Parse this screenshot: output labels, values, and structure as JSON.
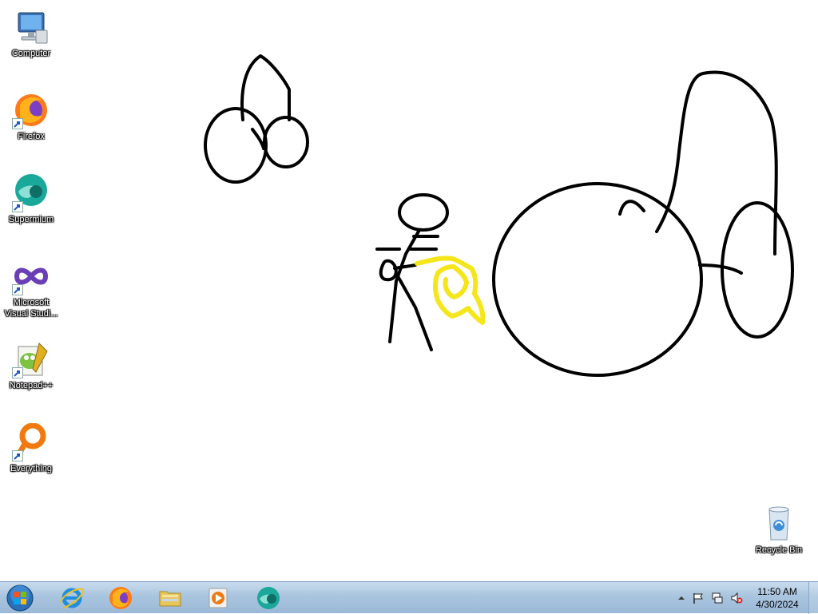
{
  "desktop": {
    "icons": [
      {
        "label": "Computer",
        "icon": "computer-icon"
      },
      {
        "label": "Firefox",
        "icon": "firefox-icon"
      },
      {
        "label": "Supermium",
        "icon": "supermium-icon"
      },
      {
        "label": "Microsoft Visual Studi...",
        "icon": "visual-studio-icon"
      },
      {
        "label": "Notepad++",
        "icon": "notepadpp-icon"
      },
      {
        "label": "Everything",
        "icon": "everything-icon"
      }
    ],
    "recycle_bin": {
      "label": "Recycle Bin",
      "icon": "recycle-bin-icon"
    }
  },
  "taskbar": {
    "start": "start-button",
    "pinned": [
      {
        "name": "internet-explorer",
        "icon": "ie-icon"
      },
      {
        "name": "firefox",
        "icon": "firefox-icon"
      },
      {
        "name": "windows-explorer",
        "icon": "folder-icon"
      },
      {
        "name": "media-player",
        "icon": "media-player-icon"
      },
      {
        "name": "supermium",
        "icon": "supermium-icon"
      }
    ],
    "tray": {
      "icons": [
        "show-hidden-icons-arrow",
        "action-center-flag-icon",
        "network-icon",
        "volume-muted-icon"
      ],
      "time": "11:50 AM",
      "date": "4/30/2024"
    }
  },
  "colors": {
    "taskbar_top": "#c9dcee",
    "taskbar_bottom": "#9bb9d8",
    "drawing_stroke": "#000000",
    "drawing_highlight": "#f5e61c"
  }
}
